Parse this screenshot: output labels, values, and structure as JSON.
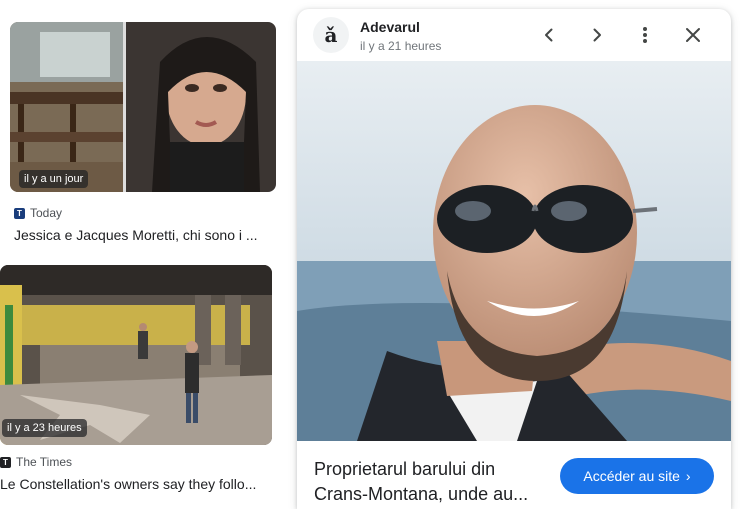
{
  "results": [
    {
      "time": "il y a un jour",
      "source_badge": "T",
      "source": "Today",
      "headline": "Jessica e Jacques Moretti, chi sono i ..."
    },
    {
      "time": "il y a 23 heures",
      "source_badge": "T",
      "source": "The Times",
      "headline": "Le Constellation's owners say they follo..."
    }
  ],
  "preview": {
    "logo_glyph": "ǎ",
    "publisher": "Adevarul",
    "time": "il y a 21 heures",
    "title": "Proprietarul barului din Crans-Montana, unde au...",
    "visit_label": "Accéder au site",
    "visit_chevron": "›",
    "accent_color": "#1a73e8"
  },
  "icons": {
    "prev": "chevron-left-icon",
    "next": "chevron-right-icon",
    "more": "more-vert-icon",
    "close": "close-icon",
    "lens": "lens-search-icon"
  }
}
